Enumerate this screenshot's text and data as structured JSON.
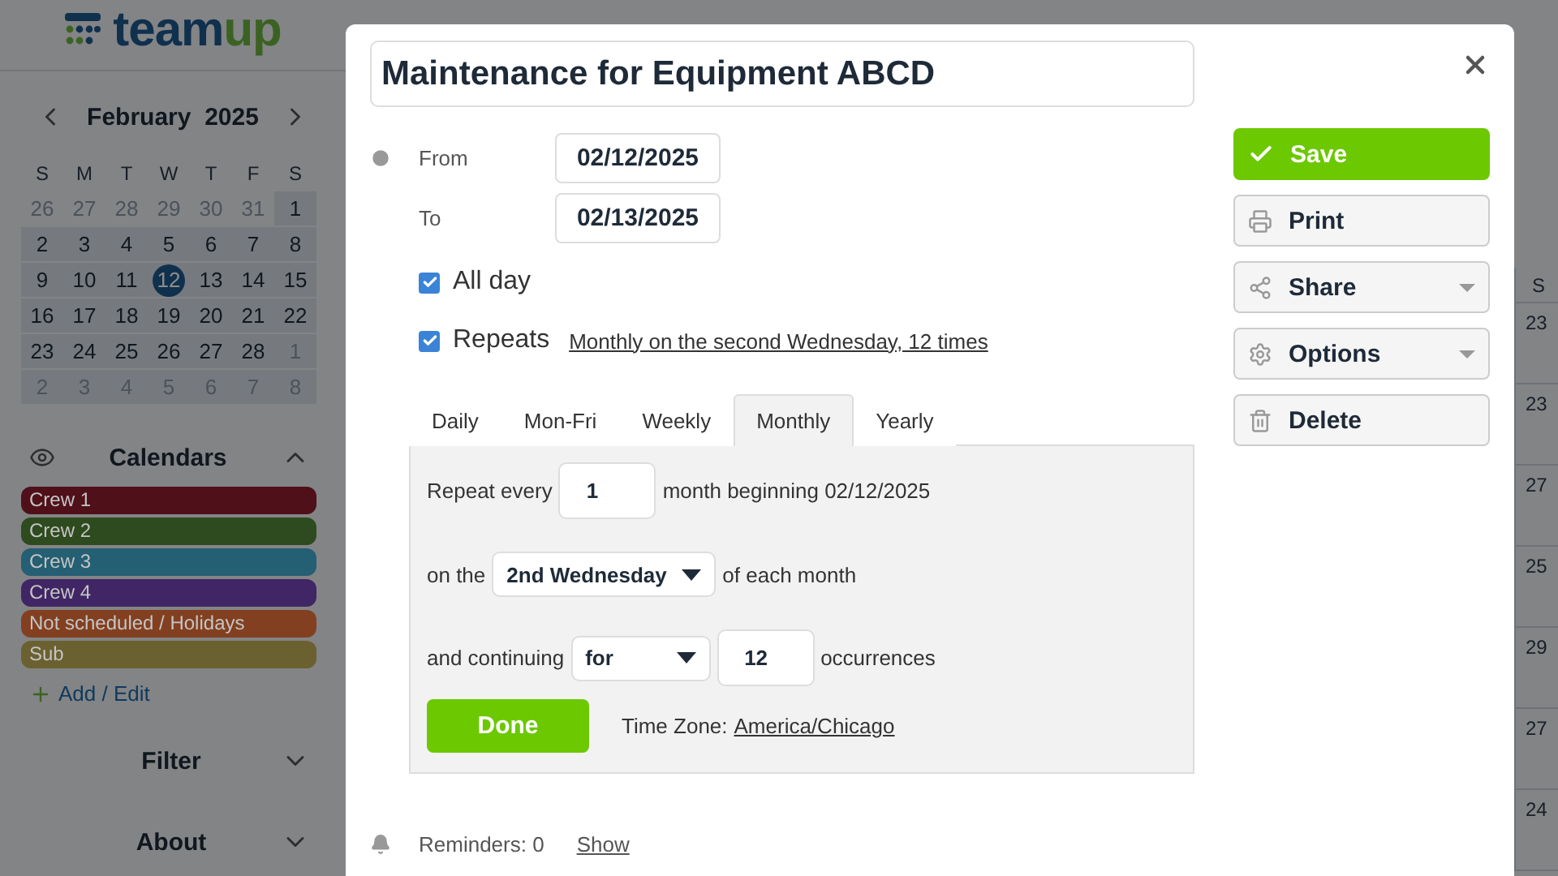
{
  "logo": {
    "text": "team",
    "accent": "up"
  },
  "mini_calendar": {
    "month": "February",
    "year": "2025",
    "weekdays": [
      "S",
      "M",
      "T",
      "W",
      "T",
      "F",
      "S"
    ],
    "weeks": [
      [
        {
          "label": "26",
          "muted": true,
          "highlighted": false,
          "selected": false
        },
        {
          "label": "27",
          "muted": true,
          "highlighted": false,
          "selected": false
        },
        {
          "label": "28",
          "muted": true,
          "highlighted": false,
          "selected": false
        },
        {
          "label": "29",
          "muted": true,
          "highlighted": false,
          "selected": false
        },
        {
          "label": "30",
          "muted": true,
          "highlighted": false,
          "selected": false
        },
        {
          "label": "31",
          "muted": true,
          "highlighted": false,
          "selected": false
        },
        {
          "label": "1",
          "muted": false,
          "highlighted": true,
          "selected": false
        }
      ],
      [
        {
          "label": "2",
          "muted": false,
          "highlighted": true,
          "selected": false
        },
        {
          "label": "3",
          "muted": false,
          "highlighted": true,
          "selected": false
        },
        {
          "label": "4",
          "muted": false,
          "highlighted": true,
          "selected": false
        },
        {
          "label": "5",
          "muted": false,
          "highlighted": true,
          "selected": false
        },
        {
          "label": "6",
          "muted": false,
          "highlighted": true,
          "selected": false
        },
        {
          "label": "7",
          "muted": false,
          "highlighted": true,
          "selected": false
        },
        {
          "label": "8",
          "muted": false,
          "highlighted": true,
          "selected": false
        }
      ],
      [
        {
          "label": "9",
          "muted": false,
          "highlighted": true,
          "selected": false
        },
        {
          "label": "10",
          "muted": false,
          "highlighted": true,
          "selected": false
        },
        {
          "label": "11",
          "muted": false,
          "highlighted": true,
          "selected": false
        },
        {
          "label": "12",
          "muted": false,
          "highlighted": true,
          "selected": true
        },
        {
          "label": "13",
          "muted": false,
          "highlighted": true,
          "selected": false
        },
        {
          "label": "14",
          "muted": false,
          "highlighted": true,
          "selected": false
        },
        {
          "label": "15",
          "muted": false,
          "highlighted": true,
          "selected": false
        }
      ],
      [
        {
          "label": "16",
          "muted": false,
          "highlighted": true,
          "selected": false
        },
        {
          "label": "17",
          "muted": false,
          "highlighted": true,
          "selected": false
        },
        {
          "label": "18",
          "muted": false,
          "highlighted": true,
          "selected": false
        },
        {
          "label": "19",
          "muted": false,
          "highlighted": true,
          "selected": false
        },
        {
          "label": "20",
          "muted": false,
          "highlighted": true,
          "selected": false
        },
        {
          "label": "21",
          "muted": false,
          "highlighted": true,
          "selected": false
        },
        {
          "label": "22",
          "muted": false,
          "highlighted": true,
          "selected": false
        }
      ],
      [
        {
          "label": "23",
          "muted": false,
          "highlighted": true,
          "selected": false
        },
        {
          "label": "24",
          "muted": false,
          "highlighted": true,
          "selected": false
        },
        {
          "label": "25",
          "muted": false,
          "highlighted": true,
          "selected": false
        },
        {
          "label": "26",
          "muted": false,
          "highlighted": true,
          "selected": false
        },
        {
          "label": "27",
          "muted": false,
          "highlighted": true,
          "selected": false
        },
        {
          "label": "28",
          "muted": false,
          "highlighted": true,
          "selected": false
        },
        {
          "label": "1",
          "muted": true,
          "highlighted": true,
          "selected": false
        }
      ],
      [
        {
          "label": "2",
          "muted": true,
          "highlighted": true,
          "selected": false
        },
        {
          "label": "3",
          "muted": true,
          "highlighted": true,
          "selected": false
        },
        {
          "label": "4",
          "muted": true,
          "highlighted": true,
          "selected": false
        },
        {
          "label": "5",
          "muted": true,
          "highlighted": true,
          "selected": false
        },
        {
          "label": "6",
          "muted": true,
          "highlighted": true,
          "selected": false
        },
        {
          "label": "7",
          "muted": true,
          "highlighted": true,
          "selected": false
        },
        {
          "label": "8",
          "muted": true,
          "highlighted": true,
          "selected": false
        }
      ]
    ]
  },
  "calendars": {
    "title": "Calendars",
    "expanded": true,
    "items": [
      {
        "name": "Crew 1",
        "color": "#501019"
      },
      {
        "name": "Crew 2",
        "color": "#2d4b1e"
      },
      {
        "name": "Crew 3",
        "color": "#245f73"
      },
      {
        "name": "Crew 4",
        "color": "#402664"
      },
      {
        "name": "Not scheduled / Holidays",
        "color": "#824020"
      },
      {
        "name": "Sub",
        "color": "#6b6030"
      }
    ],
    "add_link": "Add / Edit"
  },
  "sidebar_sections": [
    {
      "title": "Filter",
      "expanded": false
    },
    {
      "title": "About",
      "expanded": false
    }
  ],
  "background_grid": {
    "column": "S",
    "days": [
      "23",
      "23",
      "27",
      "25",
      "29",
      "27",
      "24"
    ]
  },
  "dialog": {
    "title": "Maintenance for Equipment ABCD",
    "from_label": "From",
    "from": "02/12/2025",
    "to_label": "To",
    "to": "02/13/2025",
    "all_day": {
      "label": "All day",
      "checked": true
    },
    "repeats": {
      "label": "Repeats",
      "checked": true,
      "summary": "Monthly on the second Wednesday, 12 times"
    },
    "tabs": [
      {
        "label": "Daily",
        "selected": false
      },
      {
        "label": "Mon-Fri",
        "selected": false
      },
      {
        "label": "Weekly",
        "selected": false
      },
      {
        "label": "Monthly",
        "selected": true
      },
      {
        "label": "Yearly",
        "selected": false
      }
    ],
    "repeat_every_label": "Repeat every",
    "repeat_every": "1",
    "beginning": "month beginning 02/12/2025",
    "on_the_label": "on the",
    "on_the": "2nd Wednesday",
    "on_the_suffix": "of each month",
    "continuing_label": "and continuing",
    "continuing": "for",
    "occurrences": "12",
    "occurrences_label": "occurrences",
    "done": "Done",
    "time_zone_label": "Time Zone:",
    "time_zone": "America/Chicago",
    "reminders": "Reminders: 0",
    "reminders_link": "Show",
    "actions": [
      {
        "kind": "save",
        "label": "Save",
        "menu": false
      },
      {
        "kind": "print",
        "label": "Print",
        "menu": false
      },
      {
        "kind": "share",
        "label": "Share",
        "menu": true
      },
      {
        "kind": "options",
        "label": "Options",
        "menu": true
      },
      {
        "kind": "delete",
        "label": "Delete",
        "menu": false
      }
    ]
  }
}
